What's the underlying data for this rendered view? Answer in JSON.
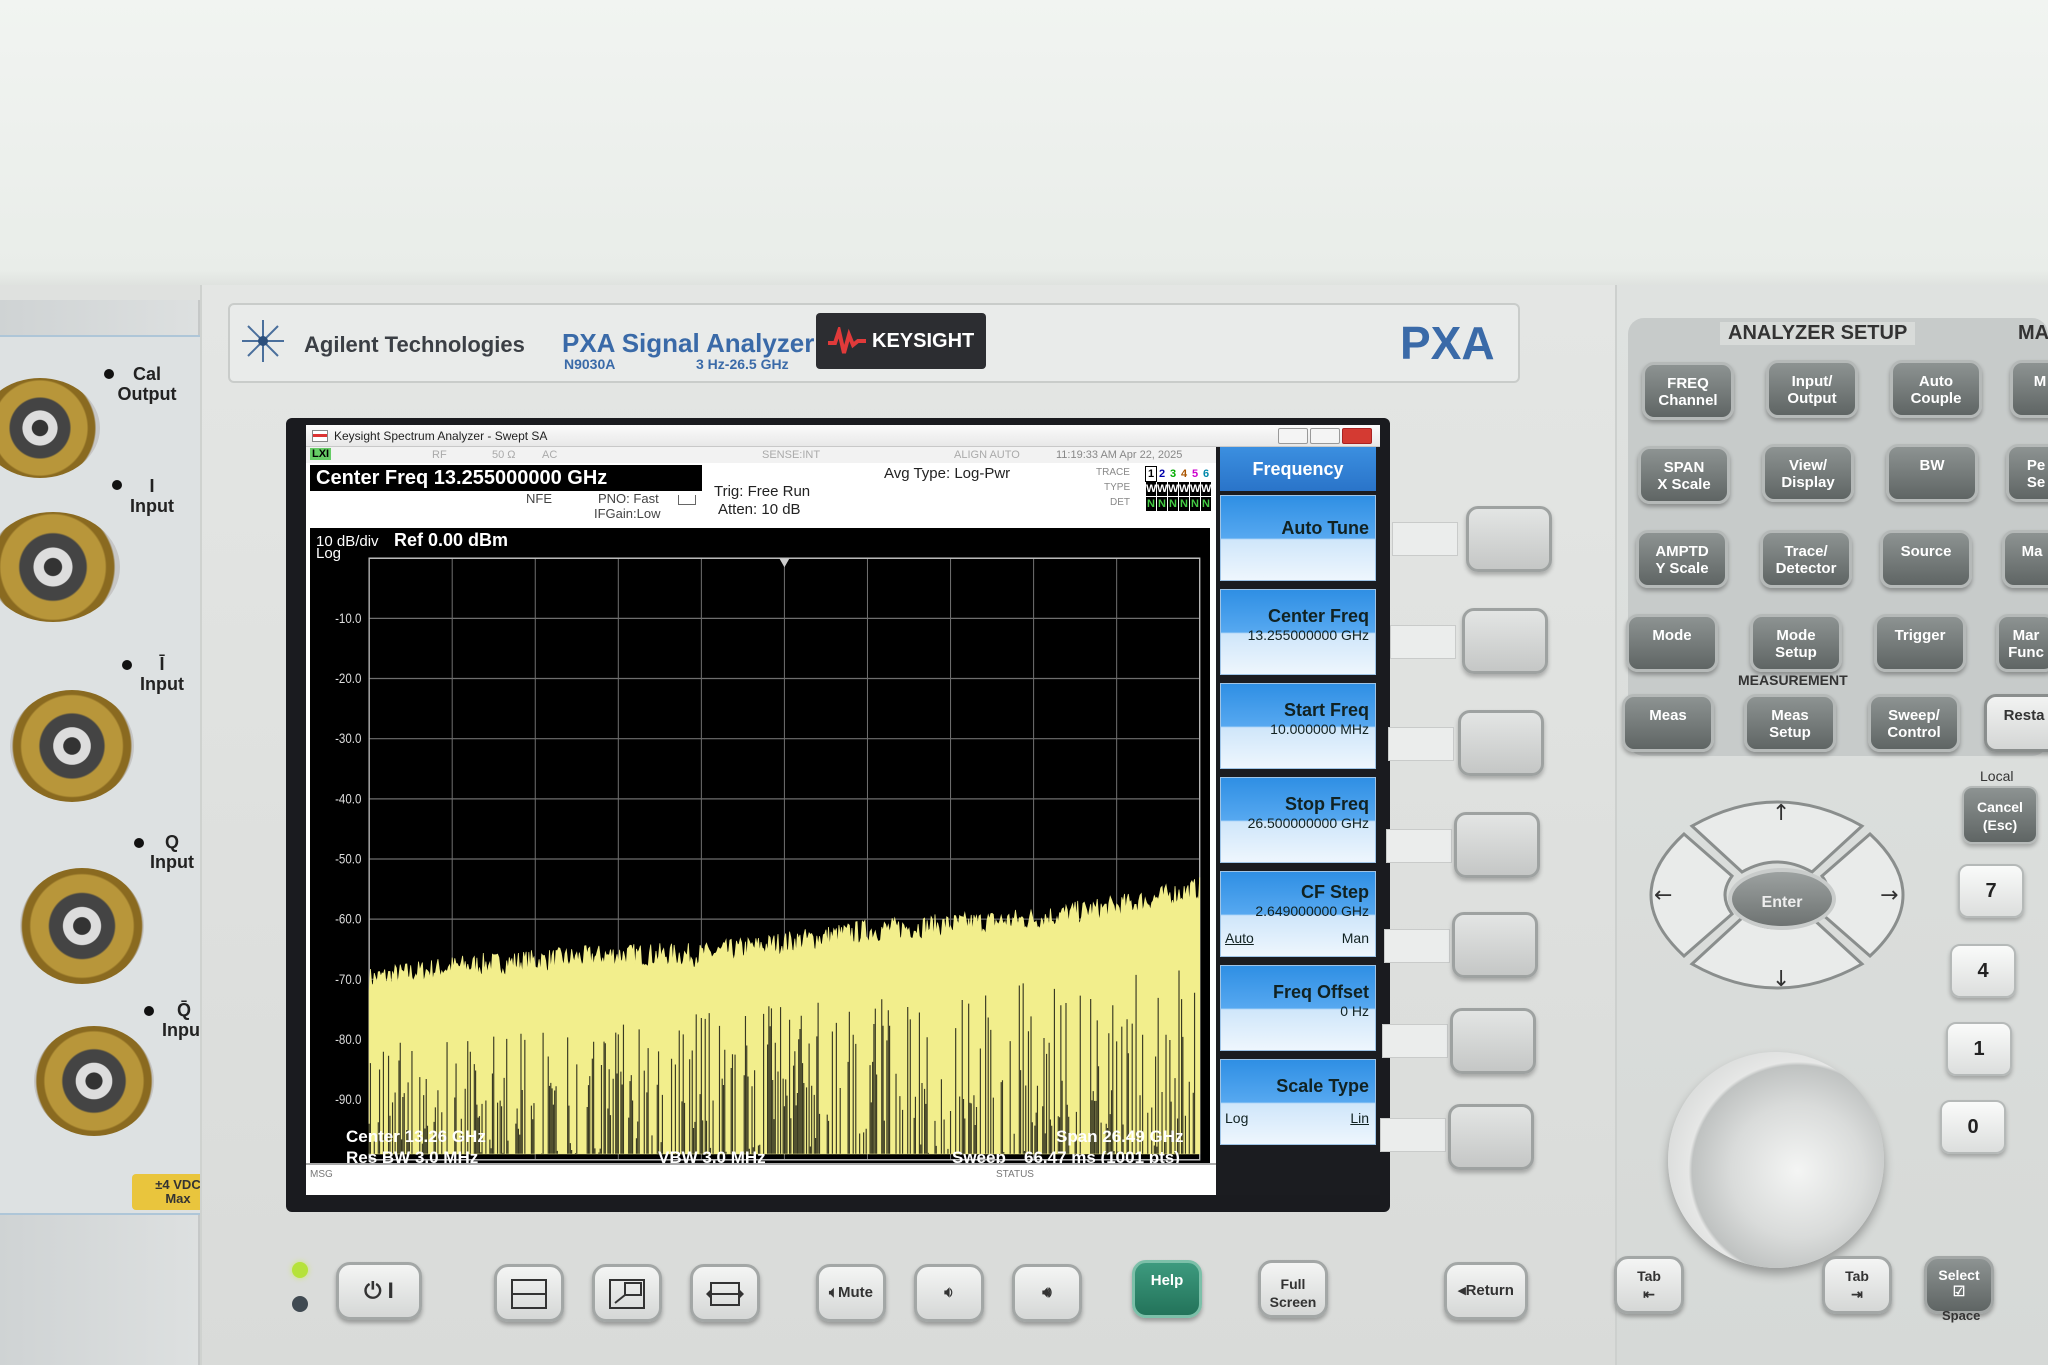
{
  "instrument": {
    "brand": "Agilent Technologies",
    "model_name": "PXA Signal Analyzer",
    "model_number": "N9030A",
    "freq_range": "3 Hz-26.5 GHz",
    "keysight_logo": "KEYSIGHT",
    "series": "PXA"
  },
  "inputs": {
    "cal_output": "Cal\nOutput",
    "i_input": "I\nInput",
    "i_bar_input": "Ī\nInput",
    "q_input": "Q\nInput",
    "q_bar_input": "Q̄\nInput",
    "warning": "±4 VDC\nMax"
  },
  "screen": {
    "window_title": "Keysight Spectrum Analyzer - Swept SA",
    "status_left": "LXI",
    "status_rf": "RF",
    "status_ohm": "50 Ω",
    "status_ac": "AC",
    "status_sense": "SENSE:INT",
    "status_align": "ALIGN AUTO",
    "timestamp": "11:19:33 AM Apr 22, 2025",
    "center_freq_banner": "Center Freq 13.255000000 GHz",
    "nfe": "NFE",
    "pno": "PNO: Fast",
    "ifgain": "IFGain:Low",
    "trig": "Trig: Free Run",
    "atten": "Atten: 10 dB",
    "avg_type": "Avg Type: Log-Pwr",
    "trace_label": "TRACE",
    "type_label": "TYPE",
    "det_label": "DET",
    "trace_nums": [
      "1",
      "2",
      "3",
      "4",
      "5",
      "6"
    ],
    "trace_types": [
      "W",
      "W",
      "W",
      "W",
      "W",
      "W"
    ],
    "trace_dets": [
      "N",
      "N",
      "N",
      "N",
      "N",
      "N"
    ],
    "scale": "10 dB/div",
    "scale_log": "Log",
    "ref_level": "Ref 0.00 dBm",
    "center_readout": "Center 13.26 GHz",
    "span_readout": "Span 26.49 GHz",
    "rbw_readout": "Res BW 3.0 MHz",
    "vbw_readout": "VBW 3.0 MHz",
    "sweep_label": "Sweep",
    "sweep_readout": "66.47 ms (1001 pts)",
    "msg_label": "MSG",
    "status_label": "STATUS"
  },
  "softkeys": {
    "menu_title": "Frequency",
    "items": [
      {
        "label": "Auto Tune",
        "value": ""
      },
      {
        "label": "Center Freq",
        "value": "13.255000000 GHz"
      },
      {
        "label": "Start Freq",
        "value": "10.000000 MHz"
      },
      {
        "label": "Stop Freq",
        "value": "26.500000000 GHz"
      },
      {
        "label": "CF Step",
        "value": "2.649000000 GHz",
        "opt_a": "Auto",
        "opt_b": "Man"
      },
      {
        "label": "Freq Offset",
        "value": "0 Hz"
      },
      {
        "label": "Scale Type",
        "value": "",
        "opt_a": "Log",
        "opt_b": "Lin"
      }
    ]
  },
  "chart_data": {
    "type": "line",
    "title": "",
    "xlabel": "",
    "ylabel": "",
    "ylim": [
      -100,
      0
    ],
    "y_ticks": [
      "-10.0",
      "-20.0",
      "-30.0",
      "-40.0",
      "-50.0",
      "-60.0",
      "-70.0",
      "-80.0",
      "-90.0"
    ],
    "x_range_ghz": [
      0.01,
      26.5
    ],
    "grid": true,
    "series": [
      {
        "x": [
          0.01,
          2.66,
          5.3,
          7.95,
          10.6,
          13.26,
          15.9,
          18.55,
          21.2,
          23.85,
          26.5
        ],
        "values": [
          -70,
          -68,
          -67,
          -66,
          -66,
          -64,
          -62,
          -61,
          -60,
          -58,
          -55
        ]
      }
    ],
    "colors": {
      "trace": "#f2ee8c",
      "grid": "#6e6e6e",
      "background": "#000000"
    }
  },
  "analyzer_setup": {
    "title": "ANALYZER SETUP",
    "next_title": "MA",
    "keys": [
      [
        "FREQ\nChannel",
        "Input/\nOutput",
        "Auto\nCouple"
      ],
      [
        "SPAN\nX Scale",
        "View/\nDisplay",
        "BW"
      ],
      [
        "AMPTD\nY Scale",
        "Trace/\nDetector",
        "Source"
      ],
      [
        "Mode",
        "Mode\nSetup",
        "Trigger"
      ],
      [
        "Meas",
        "Meas\nSetup",
        "Sweep/\nControl"
      ]
    ],
    "measurement_label": "MEASUREMENT",
    "edge_keys": [
      "M",
      "Pe\nSe",
      "Ma",
      "Mar\nFunc",
      "Resta"
    ]
  },
  "navigation": {
    "local": "Local",
    "cancel": "Cancel\n(Esc)",
    "enter": "Enter",
    "numbers": [
      "7",
      "4",
      "1",
      "0"
    ]
  },
  "bottom_keys": {
    "power": "⏻ I",
    "mute": "Mute",
    "help": "Help",
    "full_screen": "Full\nScreen",
    "return": "Return",
    "tab_left": "Tab",
    "tab_right": "Tab",
    "select": "Select",
    "space": "Space"
  }
}
